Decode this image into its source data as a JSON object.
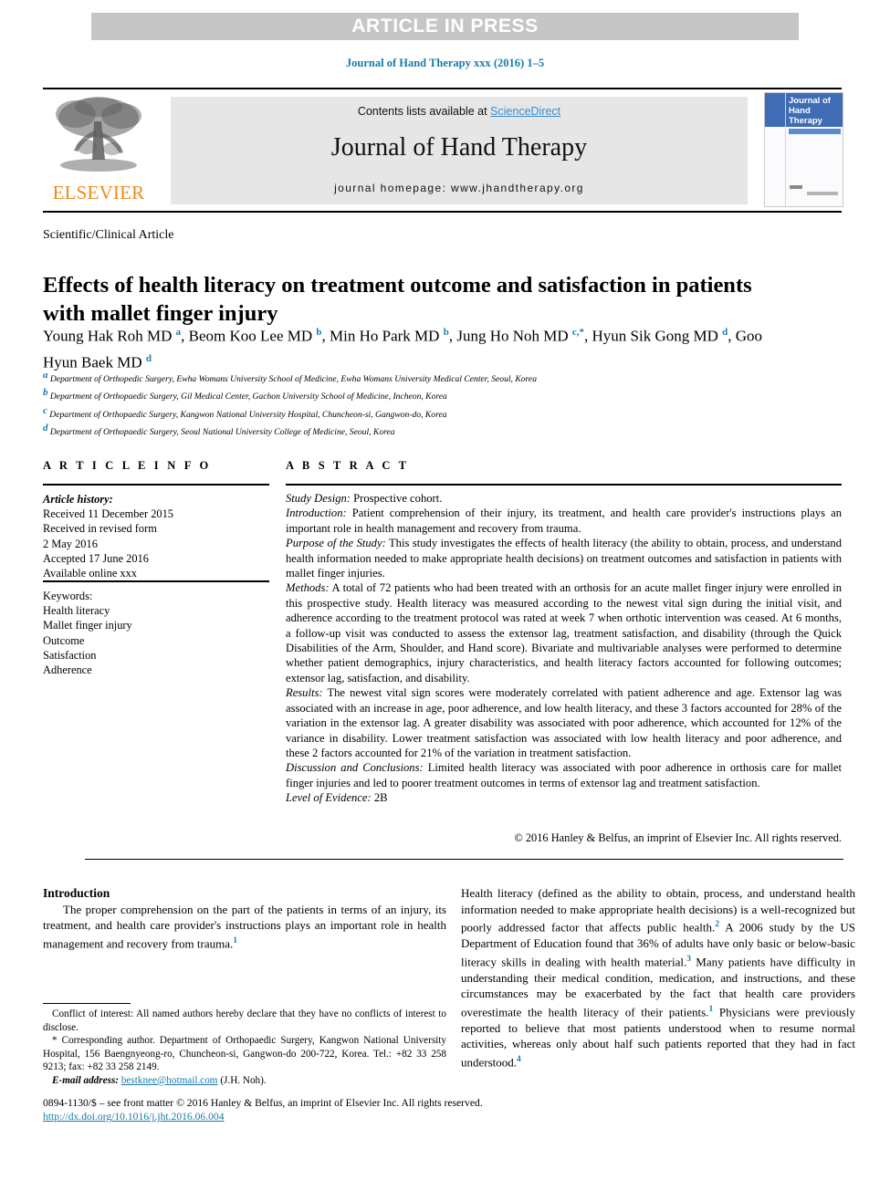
{
  "banner": {
    "text": "ARTICLE IN PRESS"
  },
  "running_citation": "Journal of Hand Therapy xxx (2016) 1–5",
  "masthead": {
    "contents_prefix": "Contents lists available at ",
    "sciencedirect": "ScienceDirect",
    "journal_name": "Journal of Hand Therapy",
    "homepage": "journal homepage: www.jhandtherapy.org",
    "publisher": "ELSEVIER",
    "cover_title": "Journal of Hand Therapy",
    "accent_blue": "#1a7aa8",
    "link_blue": "#3a8fd0",
    "elsevier_orange": "#ee8c1b",
    "cover_blue": "#3f6cb4",
    "banner_grey": "#c6c6c6"
  },
  "article": {
    "type": "Scientific/Clinical Article",
    "title": "Effects of health literacy on treatment outcome and satisfaction in patients with mallet finger injury",
    "authors_line1": "Young Hak Roh MD",
    "authors_html": "Young Hak Roh MD <sup>a</sup>, Beom Koo Lee MD <sup>b</sup>, Min Ho Park MD <sup>b</sup>, Jung Ho Noh MD <sup>c,</sup><sup>*</sup>, Hyun Sik Gong MD <sup>d</sup>, Goo Hyun Baek MD <sup>d</sup>",
    "affiliations": [
      {
        "marker": "a",
        "text": "Department of Orthopedic Surgery, Ewha Womans University School of Medicine, Ewha Womans University Medical Center, Seoul, Korea"
      },
      {
        "marker": "b",
        "text": "Department of Orthopaedic Surgery, Gil Medical Center, Gachon University School of Medicine, Incheon, Korea"
      },
      {
        "marker": "c",
        "text": "Department of Orthopaedic Surgery, Kangwon National University Hospital, Chuncheon-si, Gangwon-do, Korea"
      },
      {
        "marker": "d",
        "text": "Department of Orthopaedic Surgery, Seoul National University College of Medicine, Seoul, Korea"
      }
    ]
  },
  "article_info": {
    "heading": "A R T I C L E  I N F O",
    "history_label": "Article history:",
    "history": [
      "Received 11 December 2015",
      "Received in revised form",
      "2 May 2016",
      "Accepted 17 June 2016",
      "Available online xxx"
    ],
    "keywords_label": "Keywords:",
    "keywords": [
      "Health literacy",
      "Mallet finger injury",
      "Outcome",
      "Satisfaction",
      "Adherence"
    ]
  },
  "abstract": {
    "heading": "A B S T R A C T",
    "sections": [
      {
        "label": "Study Design:",
        "text": " Prospective cohort."
      },
      {
        "label": "Introduction:",
        "text": " Patient comprehension of their injury, its treatment, and health care provider's instructions plays an important role in health management and recovery from trauma."
      },
      {
        "label": "Purpose of the Study:",
        "text": " This study investigates the effects of health literacy (the ability to obtain, process, and understand health information needed to make appropriate health decisions) on treatment outcomes and satisfaction in patients with mallet finger injuries."
      },
      {
        "label": "Methods:",
        "text": " A total of 72 patients who had been treated with an orthosis for an acute mallet finger injury were enrolled in this prospective study. Health literacy was measured according to the newest vital sign during the initial visit, and adherence according to the treatment protocol was rated at week 7 when orthotic intervention was ceased. At 6 months, a follow-up visit was conducted to assess the extensor lag, treatment satisfaction, and disability (through the Quick Disabilities of the Arm, Shoulder, and Hand score). Bivariate and multivariable analyses were performed to determine whether patient demographics, injury characteristics, and health literacy factors accounted for following outcomes; extensor lag, satisfaction, and disability."
      },
      {
        "label": "Results:",
        "text": " The newest vital sign scores were moderately correlated with patient adherence and age. Extensor lag was associated with an increase in age, poor adherence, and low health literacy, and these 3 factors accounted for 28% of the variation in the extensor lag. A greater disability was associated with poor adherence, which accounted for 12% of the variance in disability. Lower treatment satisfaction was associated with low health literacy and poor adherence, and these 2 factors accounted for 21% of the variation in treatment satisfaction."
      },
      {
        "label": "Discussion and Conclusions:",
        "text": " Limited health literacy was associated with poor adherence in orthosis care for mallet finger injuries and led to poorer treatment outcomes in terms of extensor lag and treatment satisfaction."
      },
      {
        "label": "Level of Evidence:",
        "text": " 2B"
      }
    ],
    "copyright": "© 2016 Hanley & Belfus, an imprint of Elsevier Inc. All rights reserved."
  },
  "body": {
    "left": {
      "section_title": "Introduction",
      "paragraph": "The proper comprehension on the part of the patients in terms of an injury, its treatment, and health care provider's instructions plays an important role in health management and recovery from trauma.",
      "ref": "1"
    },
    "right": {
      "part1": "Health literacy (defined as the ability to obtain, process, and understand health information needed to make appropriate health decisions) is a well-recognized but poorly addressed factor that affects public health.",
      "ref1": "2",
      "part2": " A 2006 study by the US Department of Education found that 36% of adults have only basic or below-basic literacy skills in dealing with health material.",
      "ref2": "3",
      "part3": " Many patients have difficulty in understanding their medical condition, medication, and instructions, and these circumstances may be exacerbated by the fact that health care providers overestimate the health literacy of their patients.",
      "ref3": "1",
      "part4": " Physicians were previously reported to believe that most patients understood when to resume normal activities, whereas only about half such patients reported that they had in fact understood.",
      "ref4": "4"
    }
  },
  "footnotes": {
    "conflict": "Conflict of interest: All named authors hereby declare that they have no conflicts of interest to disclose.",
    "corresponding": "* Corresponding author. Department of Orthopaedic Surgery, Kangwon National University Hospital, 156 Baengnyeong-ro, Chuncheon-si, Gangwon-do 200-722, Korea. Tel.: +82 33 258 9213; fax: +82 33 258 2149.",
    "email_label": "E-mail address:",
    "email": "bestknee@hotmail.com",
    "email_suffix": " (J.H. Noh)."
  },
  "page_footer": {
    "issn_line": "0894-1130/$ – see front matter © 2016 Hanley & Belfus, an imprint of Elsevier Inc. All rights reserved.",
    "doi": "http://dx.doi.org/10.1016/j.jht.2016.06.004"
  }
}
